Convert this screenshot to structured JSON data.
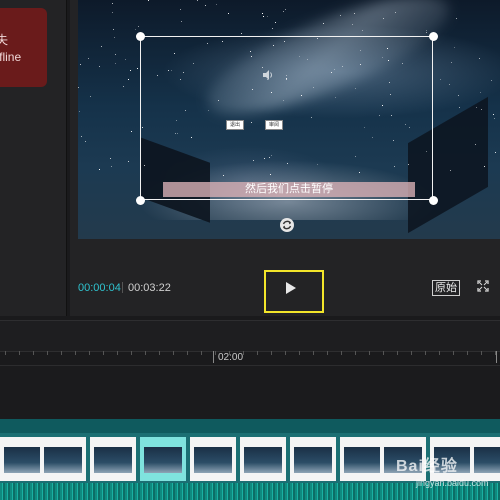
{
  "left_panel": {
    "badge_line1": "失",
    "badge_line2": "ffline"
  },
  "player": {
    "subtitle": "然后我们点击暂停",
    "tiny_buttons": [
      "退出",
      "审阅"
    ],
    "time_current": "00:00:04",
    "time_total": "00:03:22",
    "ratio_label": "原始",
    "icons": {
      "speaker": "speaker-icon",
      "rotate": "rotate-icon",
      "play": "play-icon",
      "fullscreen": "fullscreen-icon"
    },
    "colors": {
      "time_current": "#2fc3cf",
      "highlight": "#f2e52a"
    }
  },
  "timeline": {
    "ruler_label": "02:00",
    "watermark": "Bai经验",
    "watermark_sub": "jingyan.baidu.com"
  }
}
